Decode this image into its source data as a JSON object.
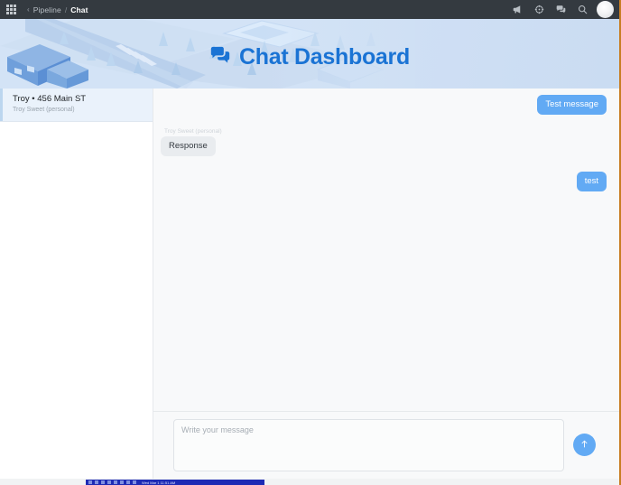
{
  "topbar": {
    "app_grid_icon": "grid-apps-icon",
    "breadcrumb": {
      "back": "‹",
      "parent": "Pipeline",
      "separator": "/",
      "current": "Chat"
    },
    "icons": [
      {
        "name": "megaphone-icon",
        "label": "Announcements"
      },
      {
        "name": "help-circle-icon",
        "label": "Help"
      },
      {
        "name": "chat-bubbles-icon",
        "label": "Messages"
      },
      {
        "name": "search-icon",
        "label": "Search"
      }
    ],
    "avatar": "user-avatar",
    "bg_color": "#343a40"
  },
  "hero": {
    "title": "Chat Dashboard",
    "icon": "chat-bubbles-icon",
    "title_color": "#1a73d4",
    "bg_color": "#cfe0f4"
  },
  "sidebar": {
    "conversations": [
      {
        "title": "Troy • 456 Main ST",
        "subtitle": "Troy Sweet (personal)",
        "selected": true
      }
    ]
  },
  "chat": {
    "messages": [
      {
        "direction": "out",
        "author": "",
        "text": "Test message"
      },
      {
        "direction": "in",
        "author": "Troy Sweet (personal)",
        "text": "Response"
      },
      {
        "direction": "out",
        "author": "",
        "text": "test"
      }
    ],
    "outgoing_color": "#62aaf4",
    "incoming_color": "#e9ecef"
  },
  "composer": {
    "placeholder": "Write your message",
    "value": "",
    "send_button": {
      "name": "send-button",
      "icon": "arrow-up-icon",
      "color": "#62aaf4"
    }
  },
  "taskbar": {
    "clock": "Wed Mar 1  11:51 AM",
    "bg_color": "#1d2ab5"
  }
}
